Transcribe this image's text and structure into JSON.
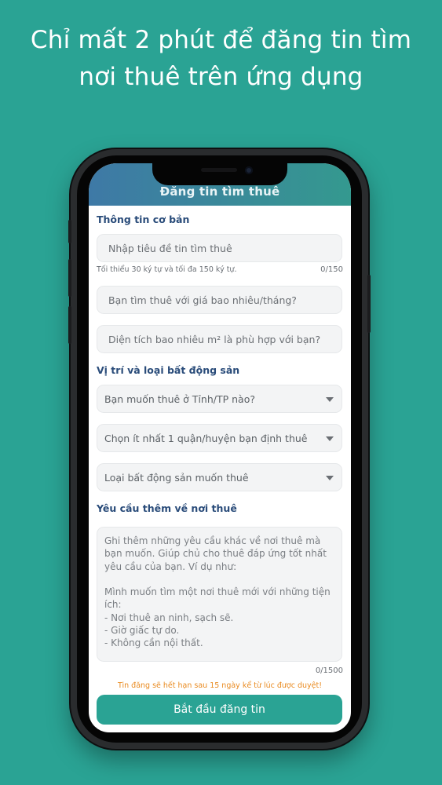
{
  "headline": {
    "line1": "Chỉ mất 2 phút để đăng tin tìm",
    "line2": "nơi thuê trên ứng dụng"
  },
  "app": {
    "title": "Đăng tin tìm thuê"
  },
  "sections": {
    "basic": "Thông tin cơ bản",
    "location": "Vị trí và loại bất động sản",
    "extra": "Yêu cầu thêm về nơi thuê"
  },
  "form": {
    "title_placeholder": "Nhập tiêu đề tin tìm thuê",
    "title_hint": "Tối thiểu 30 ký tự và tối đa 150 ký tự.",
    "title_counter": "0/150",
    "price_placeholder": "Bạn tìm thuê với giá bao nhiêu/tháng?",
    "area_placeholder": "Diện tích bao nhiêu m² là phù hợp với bạn?",
    "province_select": "Bạn muốn thuê ở Tỉnh/TP nào?",
    "district_select": "Chọn ít nhất 1 quận/huyện bạn định thuê",
    "type_select": "Loại bất động sản muốn thuê",
    "extra_placeholder": "Ghi thêm những yêu cầu khác về nơi thuê mà bạn muốn. Giúp chủ cho thuê đáp ứng tốt nhất yêu cầu của bạn. Ví dụ như:\n\nMình muốn tìm một nơi thuê mới với những tiện ích:\n- Nơi thuê an ninh, sạch sẽ.\n- Giờ giấc tự do.\n- Không cần nội thất.",
    "extra_counter": "0/1500"
  },
  "footer": {
    "expire_note": "Tin đăng sẽ hết hạn sau 15 ngày kể từ lúc được duyệt!",
    "submit_label": "Bắt đầu đăng tin"
  }
}
